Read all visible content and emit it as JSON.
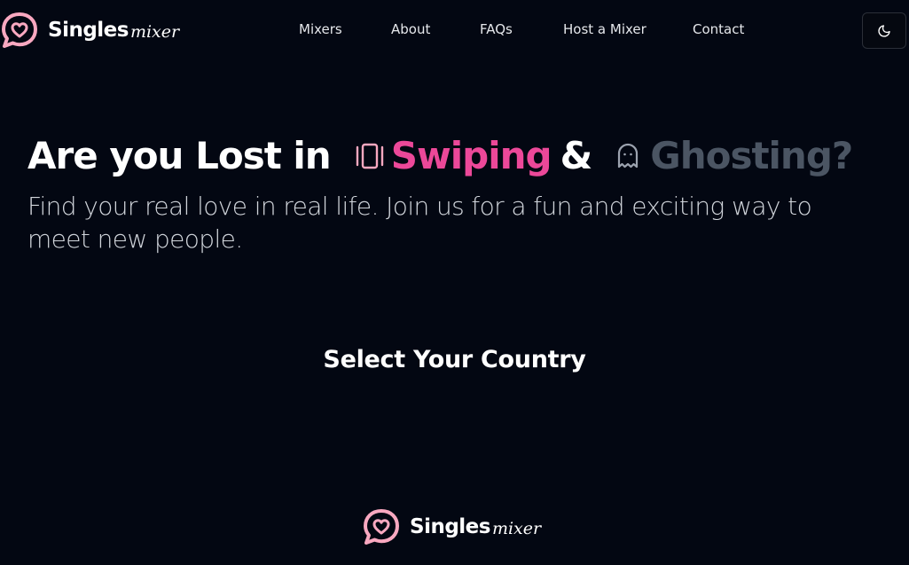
{
  "brand": {
    "name_bold": "Singles",
    "name_script": "mixer",
    "color_pink": "#f9a8c0",
    "logo_icon": "heart-chat-bubble-icon"
  },
  "nav": {
    "items": [
      {
        "label": "Mixers"
      },
      {
        "label": "About"
      },
      {
        "label": "FAQs"
      },
      {
        "label": "Host a Mixer"
      },
      {
        "label": "Contact"
      }
    ],
    "theme_toggle_icon": "moon-icon"
  },
  "hero": {
    "title_part1": "Are you Lost in",
    "title_swiping": "Swiping",
    "title_amp": "&",
    "title_ghosting": "Ghosting?",
    "swiping_icon": "cards-icon",
    "ghosting_icon": "ghost-icon",
    "accent_color": "#ec4899",
    "muted_color": "#4b5563",
    "subtitle": "Find your real love in real life. Join us for a fun and exciting way to meet new people."
  },
  "country_section": {
    "heading": "Select Your Country"
  },
  "footer": {
    "brand_bold": "Singles",
    "brand_script": "mixer"
  }
}
